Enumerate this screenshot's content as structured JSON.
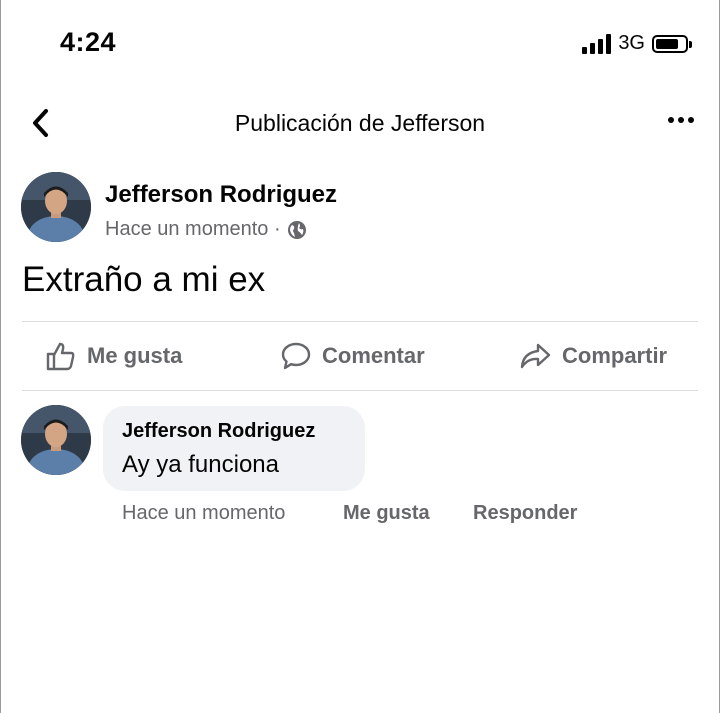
{
  "status_bar": {
    "time": "4:24",
    "network": "3G",
    "battery_level": 0.8
  },
  "nav": {
    "title": "Publicación de Jefferson"
  },
  "post": {
    "author": "Jefferson Rodriguez",
    "timestamp": "Hace un momento · ",
    "privacy_icon": "globe-icon",
    "text": "Extraño a mi ex"
  },
  "actions": {
    "like": "Me gusta",
    "comment": "Comentar",
    "share": "Compartir"
  },
  "comment": {
    "author": "Jefferson Rodriguez",
    "text": "Ay ya funciona",
    "timestamp": "Hace un momento",
    "like": "Me gusta",
    "reply": "Responder"
  },
  "colors": {
    "secondary_text": "#65676b",
    "bubble_bg": "#f0f2f5",
    "divider": "#dadde1"
  }
}
